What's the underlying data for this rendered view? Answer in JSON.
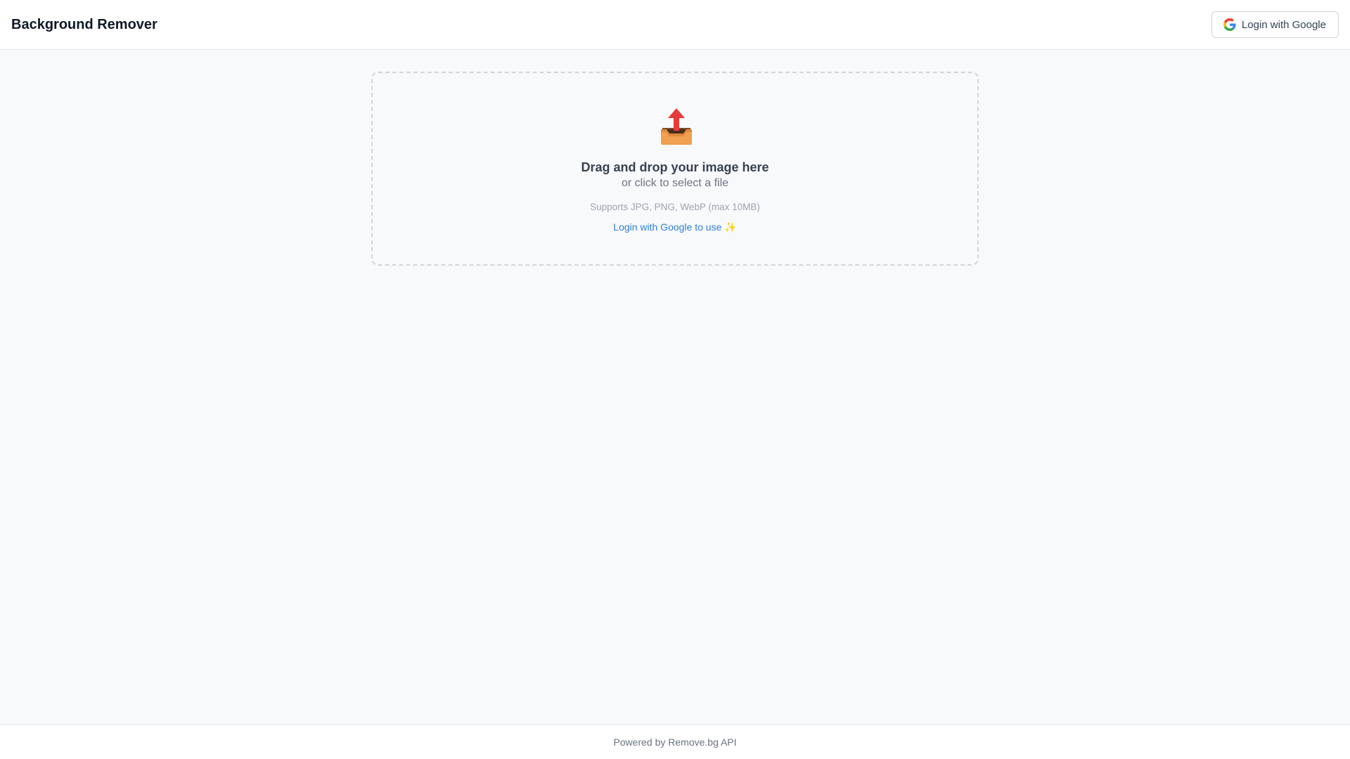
{
  "header": {
    "title": "Background Remover",
    "login_button_label": "Login with Google",
    "login_icon": "google-icon"
  },
  "dropzone": {
    "icon": "outbox-tray-icon",
    "title": "Drag and drop your image here",
    "subtitle": "or click to select a file",
    "formats": "Supports JPG, PNG, WebP (max 10MB)",
    "login_prompt": "Login with Google to use",
    "login_prompt_emoji": "✨"
  },
  "footer": {
    "text": "Powered by Remove.bg API"
  },
  "colors": {
    "background": "#f8f9fb",
    "link": "#2f7fd8",
    "border": "#d1d5db"
  }
}
